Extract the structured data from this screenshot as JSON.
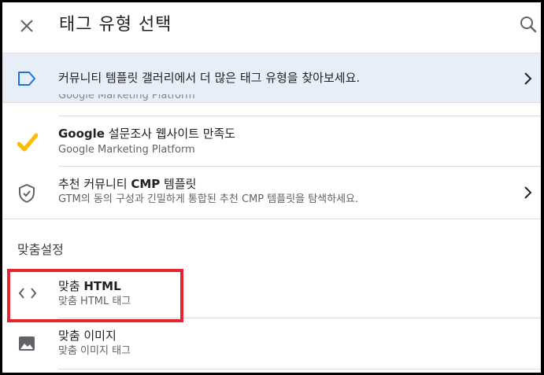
{
  "header": {
    "title": "태그 유형 선택",
    "close_icon": "close-icon",
    "search_icon": "search-icon"
  },
  "banner": {
    "text": "커뮤니티 템플릿 갤러리에서 더 많은 태그 유형을 찾아보세요.",
    "icon": "label-tag-icon",
    "accent_color": "#1a73e8"
  },
  "peek_text": "Google Marketing Platform",
  "items": [
    {
      "name_prefix": "Google",
      "name_rest": " 설문조사 웹사이트 만족도",
      "subtitle": "Google Marketing Platform",
      "icon": "check-mark-icon",
      "icon_color": "#fbbc04"
    },
    {
      "name_prefix": "추천 커뮤니티 ",
      "name_bold": "CMP",
      "name_rest": " 템플릿",
      "subtitle": "GTM의 동의 구성과 긴밀하게 통합된 추천 CMP 템플릿을 탐색하세요.",
      "icon": "shield-check-icon"
    }
  ],
  "section": {
    "label": "맞춤설정"
  },
  "custom_items": [
    {
      "name_prefix": "맞춤 ",
      "name_bold": "HTML",
      "subtitle": "맞춤 HTML 태그",
      "icon": "code-brackets-icon"
    },
    {
      "name": "맞춤 이미지",
      "subtitle": "맞춤 이미지 태그",
      "icon": "image-icon"
    }
  ],
  "highlight_color": "#e0262e"
}
